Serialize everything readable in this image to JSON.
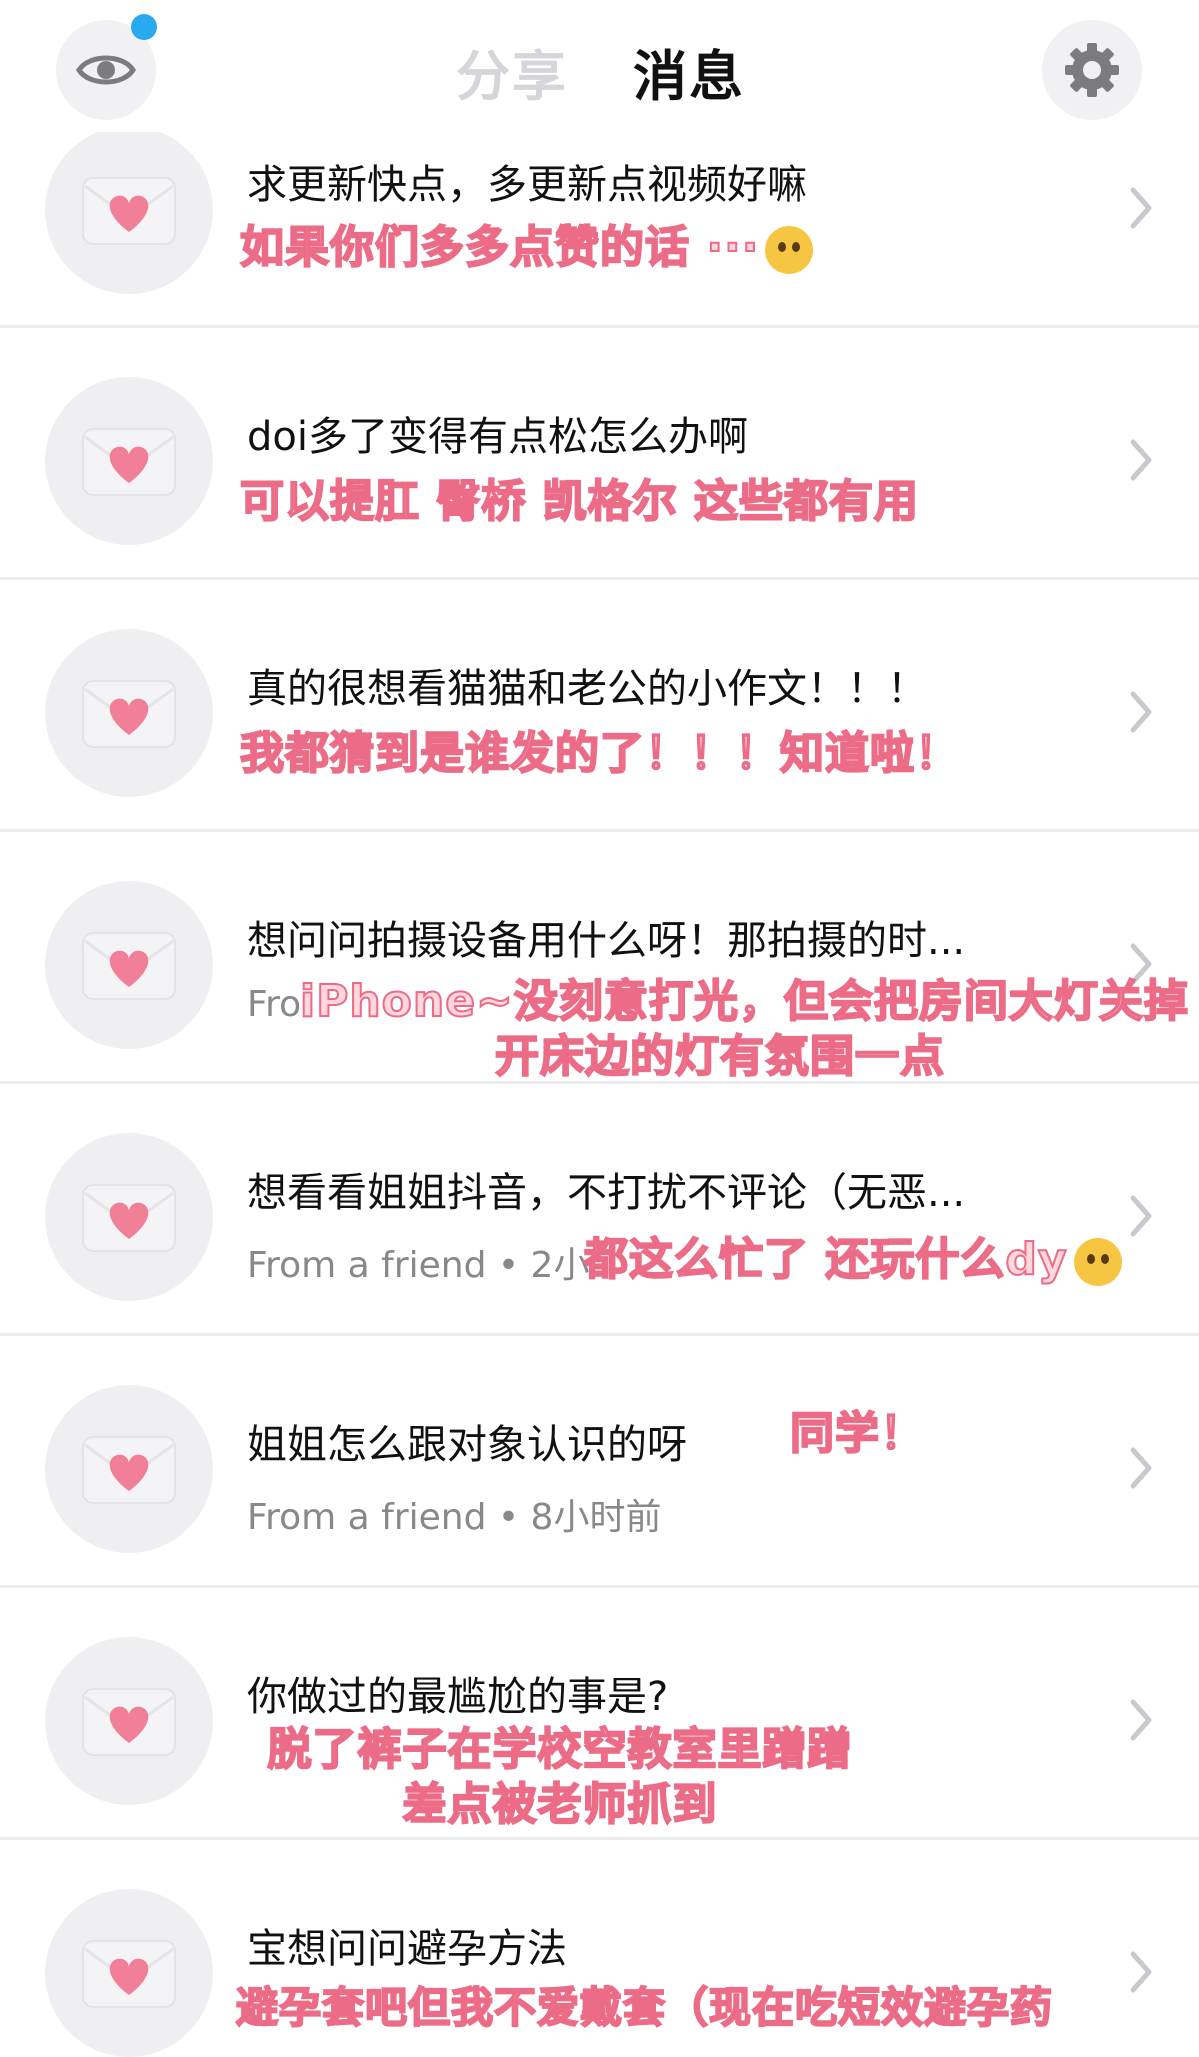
{
  "header": {
    "tab_share": "分享",
    "tab_messages": "消息",
    "left_icon": "eye-icon",
    "right_icon": "gear-icon",
    "notification_dot_color": "#29a9f0"
  },
  "messages": [
    {
      "title": "求更新快点，多更新点视频好嘛",
      "subtitle": "",
      "reply_lines": [
        "如果你们多多点赞的话 ···"
      ],
      "icon": "envelope-heart-icon"
    },
    {
      "title": "doi多了变得有点松怎么办啊",
      "subtitle": "",
      "reply_lines": [
        "可以提肛 臀桥 凯格尔 这些都有用"
      ],
      "icon": "envelope-heart-icon"
    },
    {
      "title": "真的很想看猫猫和老公的小作文！！！",
      "subtitle": "",
      "reply_lines": [
        "我都猜到是谁发的了！！！知道啦！"
      ],
      "icon": "envelope-heart-icon"
    },
    {
      "title": "想问问拍摄设备用什么呀！那拍摄的时...",
      "subtitle": "Fro",
      "reply_lines": [
        "iPhone~没刻意打光，但会把房间大灯关掉",
        "开床边的灯有氛围一点"
      ],
      "icon": "envelope-heart-icon"
    },
    {
      "title": "想看看姐姐抖音，不打扰不评论（无恶...",
      "subtitle": "From a friend • 2小",
      "reply_lines": [
        "都这么忙了 还玩什么dy"
      ],
      "icon": "envelope-heart-icon"
    },
    {
      "title": "姐姐怎么跟对象认识的呀",
      "subtitle": "From a friend • 8小时前",
      "reply_lines": [
        "同学！"
      ],
      "icon": "envelope-heart-icon"
    },
    {
      "title": "你做过的最尴尬的事是?",
      "subtitle": "",
      "reply_lines": [
        "脱了裤子在学校空教室里蹭蹭",
        "差点被老师抓到"
      ],
      "icon": "envelope-heart-icon"
    },
    {
      "title": "宝想问问避孕方法",
      "subtitle": "",
      "reply_lines": [
        "避孕套吧但我不爱戴套（现在吃短效避孕药"
      ],
      "icon": "envelope-heart-icon"
    }
  ],
  "colors": {
    "heart": "#f27f98",
    "reply_fill": "#ffd7de",
    "reply_stroke": "#ec6b86",
    "divider": "#ececee"
  }
}
